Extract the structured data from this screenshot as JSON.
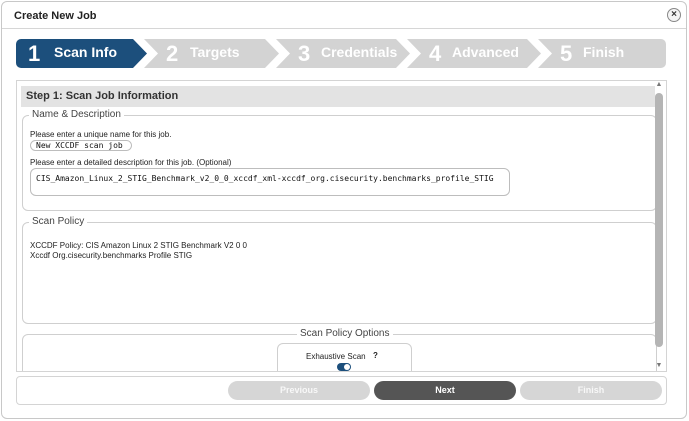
{
  "dialog": {
    "title": "Create New Job",
    "close_label": "×"
  },
  "steps": [
    {
      "num": "1",
      "label": "Scan Info"
    },
    {
      "num": "2",
      "label": "Targets"
    },
    {
      "num": "3",
      "label": "Credentials"
    },
    {
      "num": "4",
      "label": "Advanced"
    },
    {
      "num": "5",
      "label": "Finish"
    }
  ],
  "content": {
    "section_title": "Step 1: Scan Job Information",
    "name_desc": {
      "legend": "Name & Description",
      "name_prompt": "Please enter a unique name for this job.",
      "name_value": "New XCCDF scan job",
      "desc_prompt": "Please enter a detailed description for this job. (Optional)",
      "desc_value": "CIS_Amazon_Linux_2_STIG_Benchmark_v2_0_0_xccdf_xml-xccdf_org.cisecurity.benchmarks_profile_STIG"
    },
    "scan_policy": {
      "legend": "Scan Policy",
      "line1": "XCCDF Policy: CIS Amazon Linux 2 STIG Benchmark V2 0 0",
      "line2": "Xccdf Org.cisecurity.benchmarks Profile STIG"
    },
    "options": {
      "legend": "Scan Policy Options",
      "exhaustive_label": "Exhaustive Scan",
      "help_label": "?",
      "exhaustive_on": true
    }
  },
  "footer": {
    "previous": "Previous",
    "next": "Next",
    "finish": "Finish"
  },
  "colors": {
    "active_step": "#1c4f7c",
    "inactive_step": "#d3d3d3",
    "primary_button": "#555555"
  }
}
